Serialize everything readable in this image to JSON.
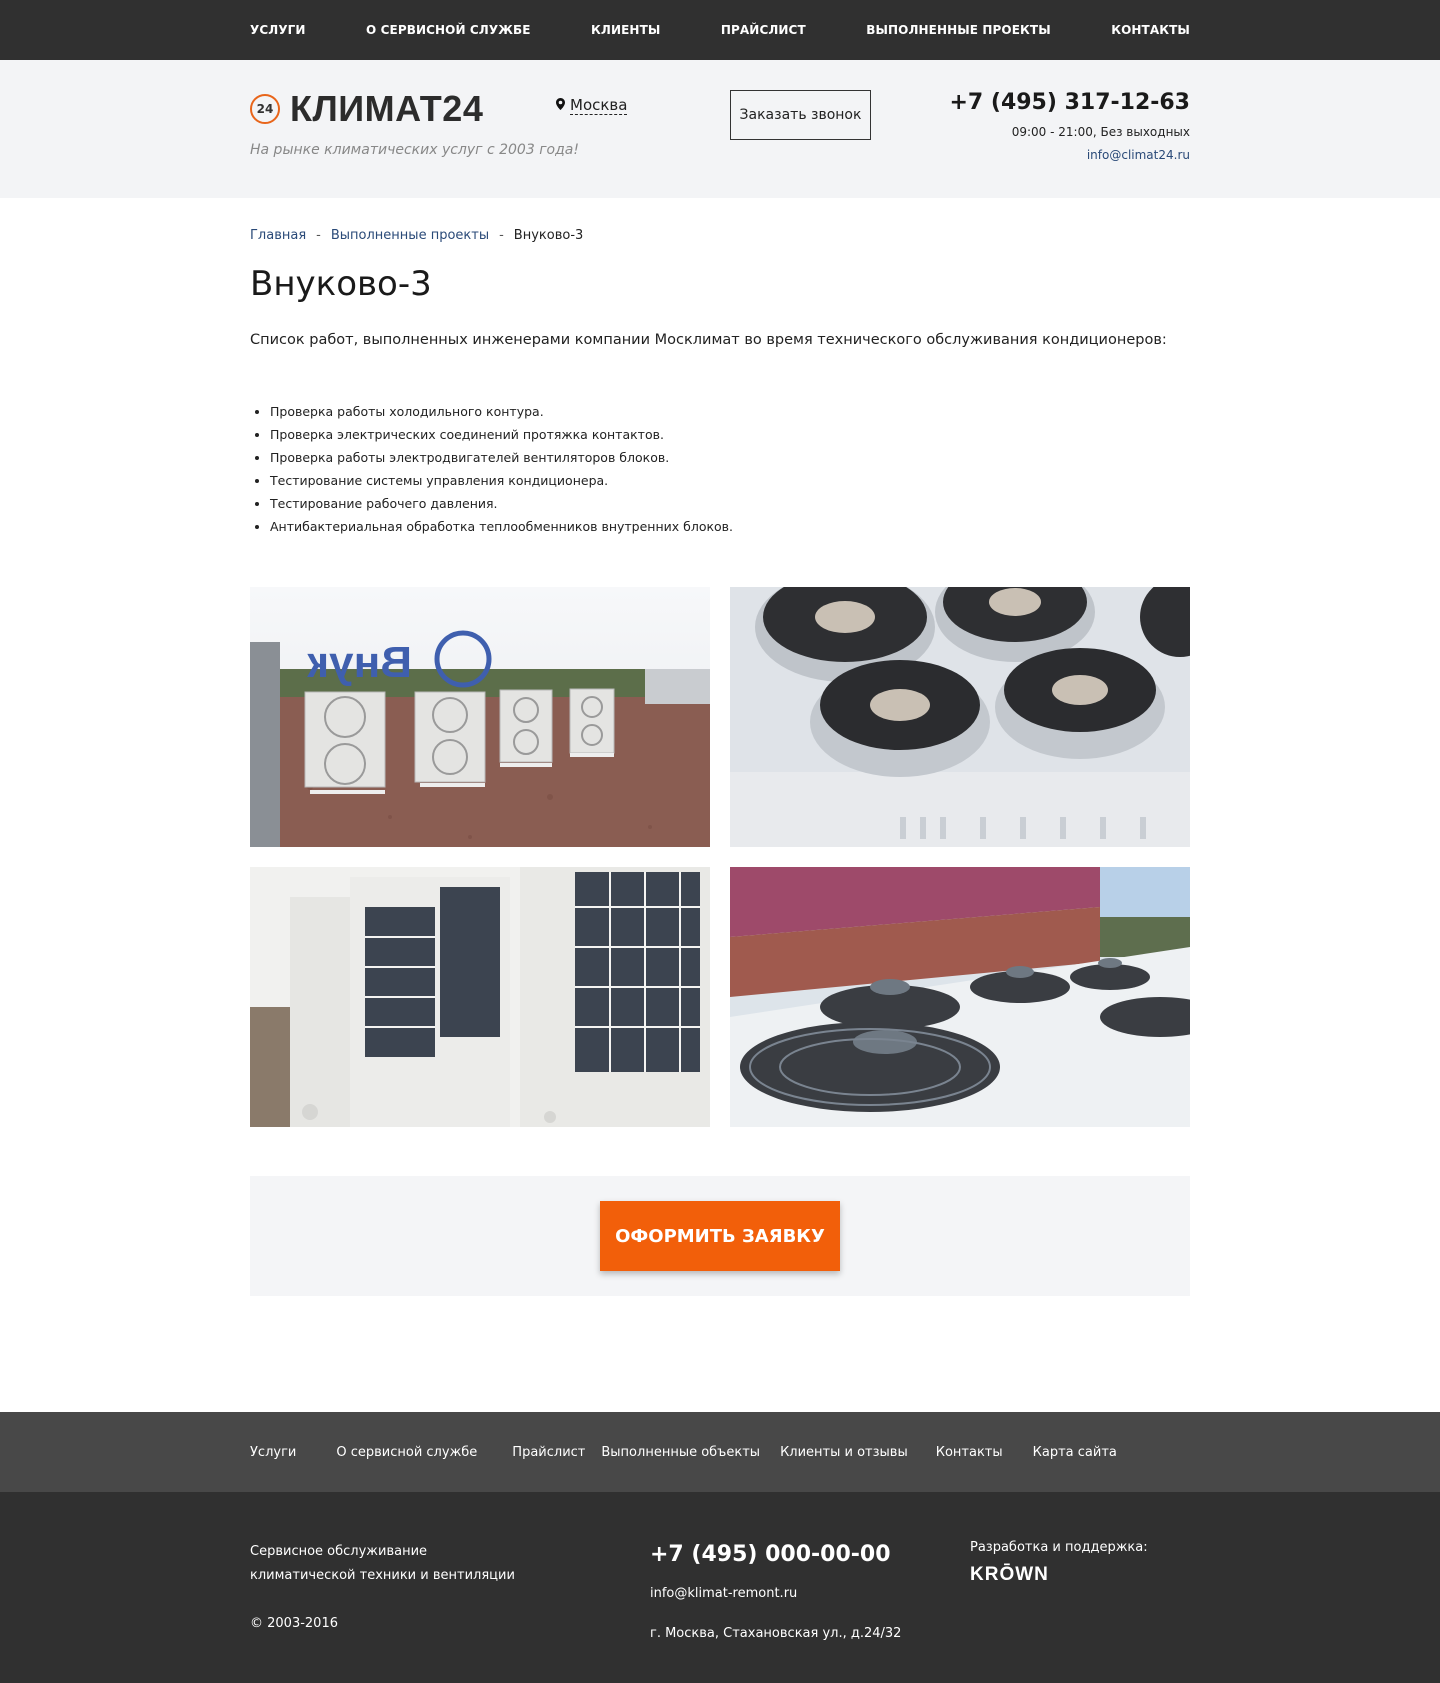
{
  "topnav": {
    "items": [
      {
        "label": "УСЛУГИ"
      },
      {
        "label": "О СЕРВИСНОЙ СЛУЖБЕ"
      },
      {
        "label": "КЛИЕНТЫ"
      },
      {
        "label": "ПРАЙСЛИСТ"
      },
      {
        "label": "ВЫПОЛНЕННЫЕ ПРОЕКТЫ"
      },
      {
        "label": "КОНТАКТЫ"
      }
    ]
  },
  "header": {
    "logo_badge": "24",
    "logo_text": "КЛИМАТ24",
    "tagline": "На рынке климатических услуг с 2003 года!",
    "city_icon": "map-pin-icon",
    "city": "Москва",
    "callback_label": "Заказать звонок",
    "phone": "+7 (495) 317-12-63",
    "hours": "09:00 - 21:00, Без выходных",
    "email": "info@climat24.ru"
  },
  "breadcrumb": {
    "home": "Главная",
    "sep": "-",
    "section": "Выполненные проекты",
    "current": "Внуково-3"
  },
  "main": {
    "title": "Внуково-3",
    "intro": "Список работ, выполненных инженерами компании Москлимат во время технического обслуживания кондиционеров:",
    "works": [
      "Проверка работы холодильного контура.",
      "Проверка электрических соединений протяжка контактов.",
      "Проверка работы электродвигателей вентиляторов блоков.",
      "Тестирование системы управления кондиционера.",
      "Тестирование рабочего давления.",
      "Антибактериальная обработка теплообменников внутренних блоков."
    ],
    "gallery_sign_text": "Внук",
    "order_button": "ОФОРМИТЬ ЗАЯВКУ"
  },
  "footer_nav": {
    "items": [
      {
        "label": "Услуги"
      },
      {
        "label": "О сервисной службе"
      },
      {
        "label": "Прайслист"
      },
      {
        "label": "Выполненные объекты"
      },
      {
        "label": "Клиенты и отзывы"
      },
      {
        "label": "Контакты"
      },
      {
        "label": "Карта сайта"
      }
    ]
  },
  "footer": {
    "description": "Сервисное обслуживание климатической техники и вентиляции",
    "copyright": "© 2003-2016",
    "phone": "+7 (495) 000-00-00",
    "email": "info@klimat-remont.ru",
    "address": "г. Москва, Стахановская ул., д.24/32",
    "developer_label": "Разработка и поддержка:",
    "developer_name": "KRŌWN"
  },
  "colors": {
    "topnav_bg": "#303030",
    "header_bg": "#f3f4f6",
    "accent_orange": "#f25f0a",
    "link_blue": "#2a4a78",
    "footer_nav_bg": "#484848",
    "footer_bg": "#303030"
  }
}
